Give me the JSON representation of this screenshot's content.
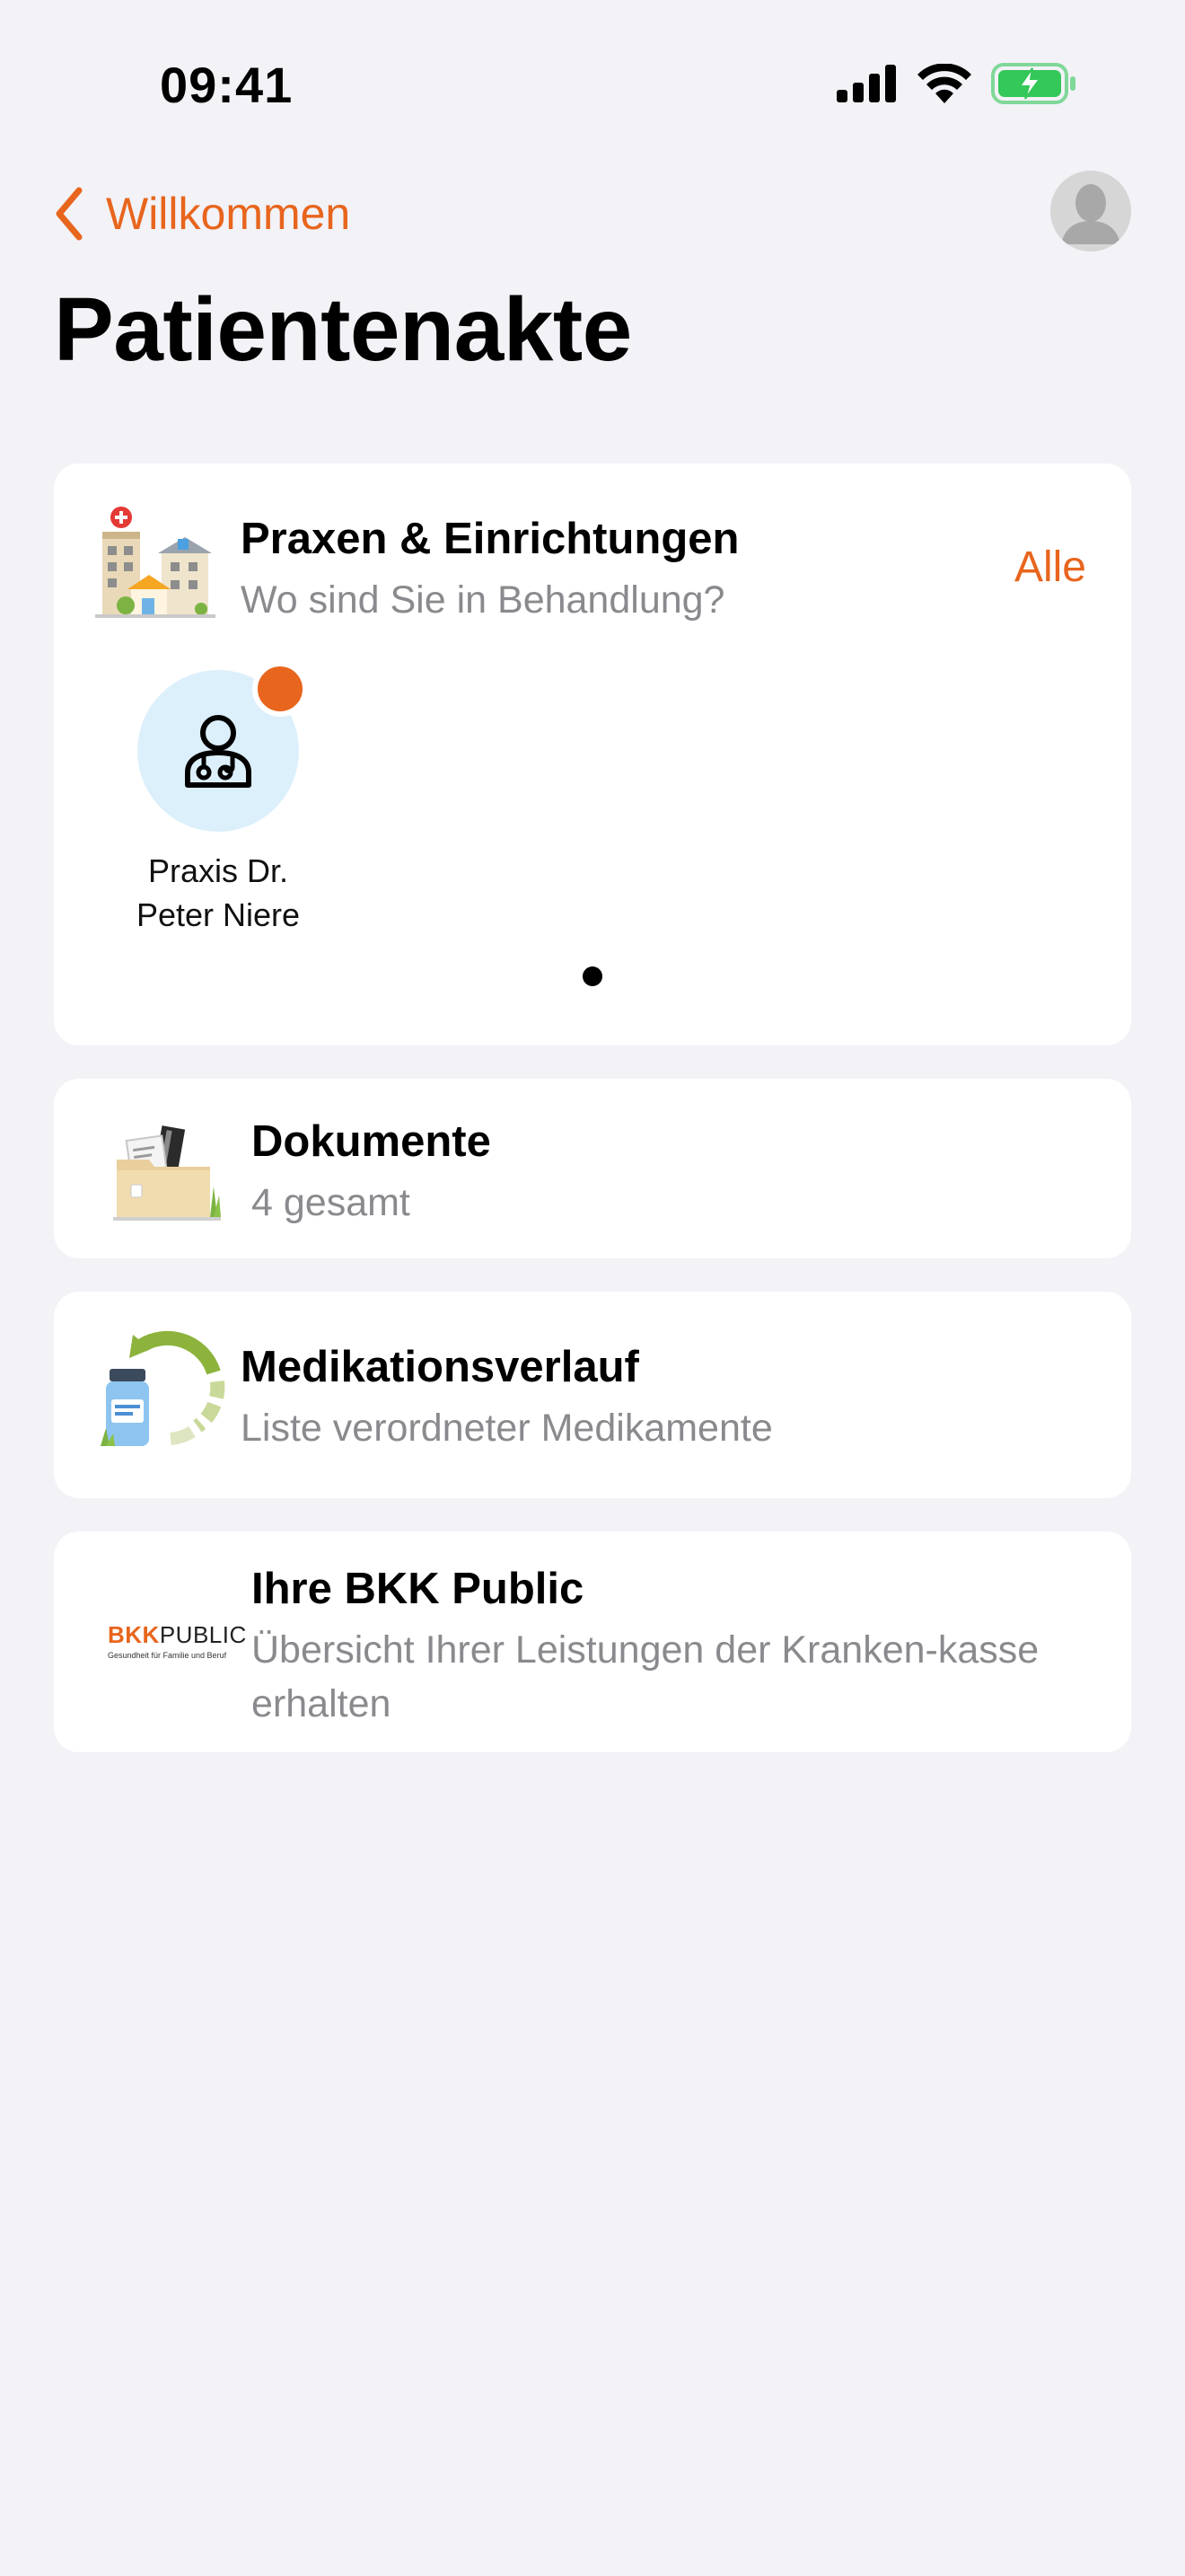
{
  "status_bar": {
    "time": "09:41",
    "icons": [
      "signal-icon",
      "wifi-icon",
      "battery-charging-icon"
    ],
    "battery_color": "#34c759"
  },
  "nav": {
    "back_label": "Willkommen",
    "back_icon": "chevron-left-icon",
    "avatar_icon": "person-avatar-icon"
  },
  "page_title": "Patientenakte",
  "colors": {
    "accent": "#e8651d",
    "background": "#f2f2f7",
    "card": "#ffffff",
    "secondary_text": "#8a8a8e",
    "doctor_circle": "#dcf0fb"
  },
  "praxen": {
    "title": "Praxen & Einrichtungen",
    "subtitle": "Wo sind Sie in Behandlung?",
    "all_label": "Alle",
    "icon": "buildings-illustration-icon",
    "items": [
      {
        "name": "Praxis Dr. Peter Niere",
        "icon": "doctor-icon",
        "has_notification": true
      }
    ],
    "page_count": 1,
    "current_page": 1
  },
  "dokumente": {
    "title": "Dokumente",
    "subtitle": "4 gesamt",
    "icon": "folder-documents-illustration-icon"
  },
  "medikation": {
    "title": "Medikationsverlauf",
    "subtitle": "Liste verordneter Medikamente",
    "icon": "medication-bottle-illustration-icon"
  },
  "bkk": {
    "title": "Ihre BKK Public",
    "subtitle": "Übersicht Ihrer Leistungen der Kranken-kasse erhalten",
    "logo_part1": "BKK",
    "logo_part2": "PUBLIC",
    "logo_tagline": "Gesundheit für Familie und Beruf"
  }
}
